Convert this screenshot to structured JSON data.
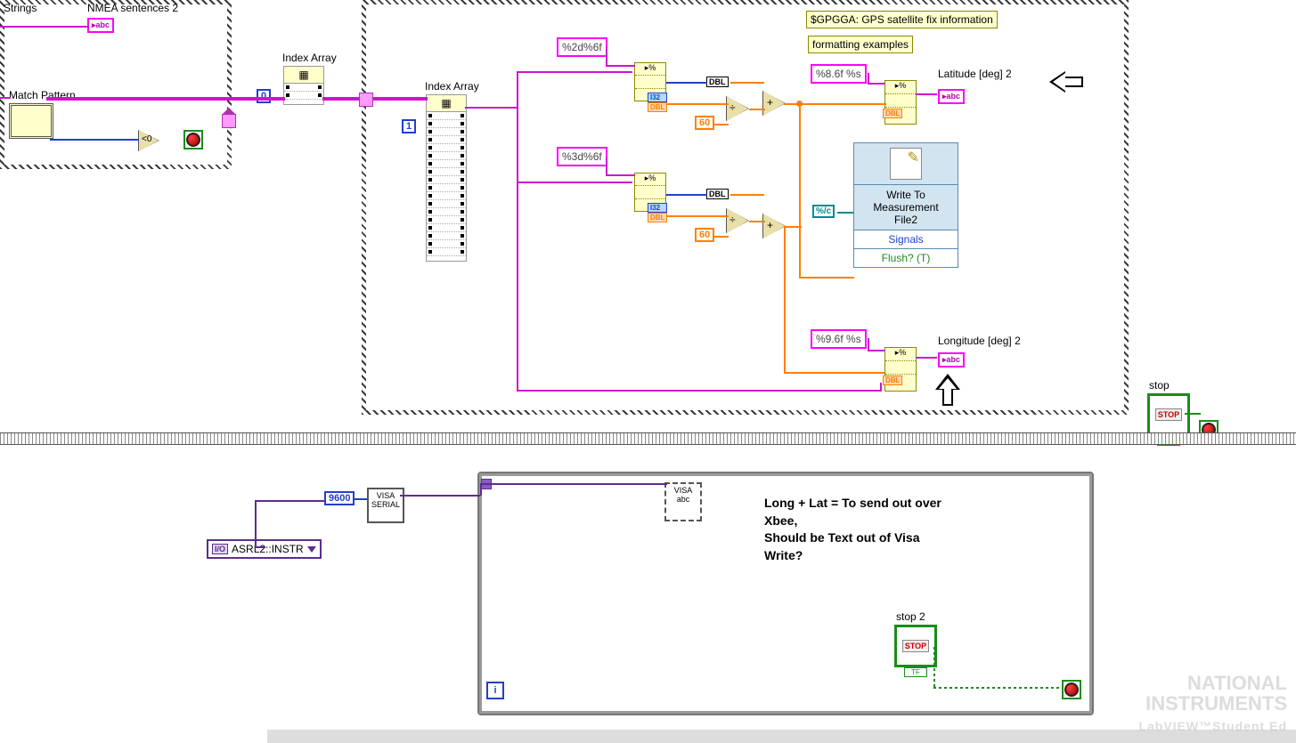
{
  "labels": {
    "strings": "Strings",
    "nmea": "NMEA sentences 2",
    "match_pattern": "Match Pattern",
    "index_array_1": "Index Array",
    "index_array_2": "Index Array",
    "gpgga": "$GPGGA: GPS satellite fix information",
    "formatting": "formatting examples",
    "latitude": "Latitude [deg] 2",
    "longitude": "Longitude [deg] 2",
    "stop": "stop",
    "stop2": "stop 2"
  },
  "format_strings": {
    "fmt1": "%2d%6f",
    "fmt2": "%3d%6f",
    "fmt_lat": "%8.6f %s",
    "fmt_lon": "%9.6f %s"
  },
  "constants": {
    "zero": "0",
    "one": "1",
    "sixty_a": "60",
    "sixty_b": "60",
    "baud": "9600",
    "cmp": "<0",
    "bslash_c": "%/c",
    "dbl1": "DBL",
    "dbl2": "DBL",
    "I32": "I32",
    "DBLs": "DBL"
  },
  "express": {
    "title": "Write To\nMeasurement\nFile2",
    "signals": "Signals",
    "flush": "Flush? (T)"
  },
  "visa": {
    "resource": "ASRL2::INSTR",
    "serial": "VISA\nSERIAL",
    "write": "VISA\nabc",
    "io_tag": "I/O"
  },
  "stop_btn": "STOP",
  "tf": "TF",
  "comment": "Long + Lat =  To send out over\nXbee,\nShould be Text out of Visa\nWrite?",
  "watermark": {
    "brand": "NATIONAL\nINSTRUMENTS",
    "product": "LabVIEW™Student Ed"
  },
  "abc": "▸abc"
}
